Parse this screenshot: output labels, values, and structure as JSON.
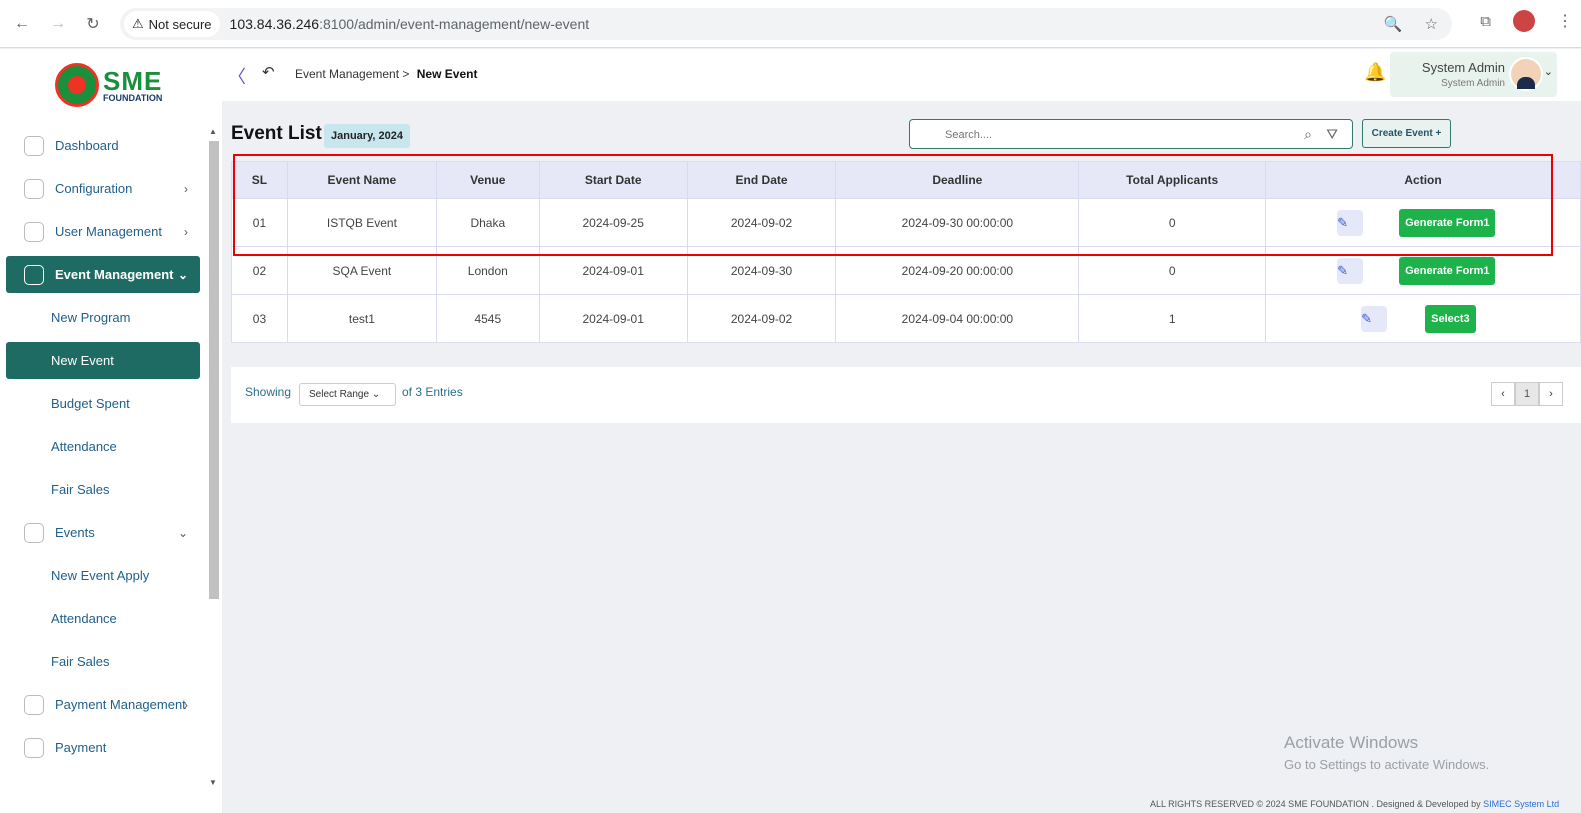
{
  "browser": {
    "security_label": "Not secure",
    "url_host": "103.84.36.246",
    "url_rest": ":8100/admin/event-management/new-event"
  },
  "logo": {
    "sme": "SME",
    "foundation": "FOUNDATION"
  },
  "sidebar": {
    "items": [
      {
        "label": "Dashboard",
        "icon": "grid-icon"
      },
      {
        "label": "Configuration",
        "icon": "config-icon",
        "chevron": "›"
      },
      {
        "label": "User Management",
        "icon": "user-icon",
        "chevron": "›"
      },
      {
        "label": "Event Management",
        "icon": "event-icon",
        "chevron": "⌄"
      },
      {
        "label": "New Program"
      },
      {
        "label": "New Event"
      },
      {
        "label": "Budget Spent"
      },
      {
        "label": "Attendance"
      },
      {
        "label": "Fair Sales"
      },
      {
        "label": "Events",
        "icon": "events-icon",
        "chevron": "⌄"
      },
      {
        "label": "New Event Apply"
      },
      {
        "label": "Attendance"
      },
      {
        "label": "Fair Sales"
      },
      {
        "label": "Payment Management",
        "icon": "payment-icon",
        "chevron": "›"
      },
      {
        "label": "Payment",
        "icon": "payment-icon"
      }
    ]
  },
  "topbar": {
    "breadcrumb_parent": "Event Management",
    "breadcrumb_sep": ">",
    "breadcrumb_current": "New Event",
    "user_name": "System Admin",
    "user_role": "System Admin"
  },
  "page": {
    "title": "Event List",
    "month_badge": "January, 2024",
    "search_placeholder": "Search....",
    "create_button": "Create Event +"
  },
  "table": {
    "headers": [
      "SL",
      "Event Name",
      "Venue",
      "Start Date",
      "End Date",
      "Deadline",
      "Total Applicants",
      "Action"
    ],
    "rows": [
      {
        "sl": "01",
        "name": "ISTQB Event",
        "venue": "Dhaka",
        "start": "2024-09-25",
        "end": "2024-09-02",
        "deadline": "2024-09-30 00:00:00",
        "applicants": "0",
        "action": "Generate Form1"
      },
      {
        "sl": "02",
        "name": "SQA Event",
        "venue": "London",
        "start": "2024-09-01",
        "end": "2024-09-30",
        "deadline": "2024-09-20 00:00:00",
        "applicants": "0",
        "action": "Generate Form1"
      },
      {
        "sl": "03",
        "name": "test1",
        "venue": "4545",
        "start": "2024-09-01",
        "end": "2024-09-02",
        "deadline": "2024-09-04 00:00:00",
        "applicants": "1",
        "action": "Select3"
      }
    ]
  },
  "pagination": {
    "showing": "Showing",
    "range": "Select Range",
    "entries": "of 3 Entries",
    "page": "1"
  },
  "watermark": {
    "line1": "Activate Windows",
    "line2": "Go to Settings to activate Windows."
  },
  "copyright": {
    "text": "ALL RIGHTS RESERVED © 2024 SME FOUNDATION . Designed & Developed by",
    "company": "SIMEC System Ltd"
  }
}
